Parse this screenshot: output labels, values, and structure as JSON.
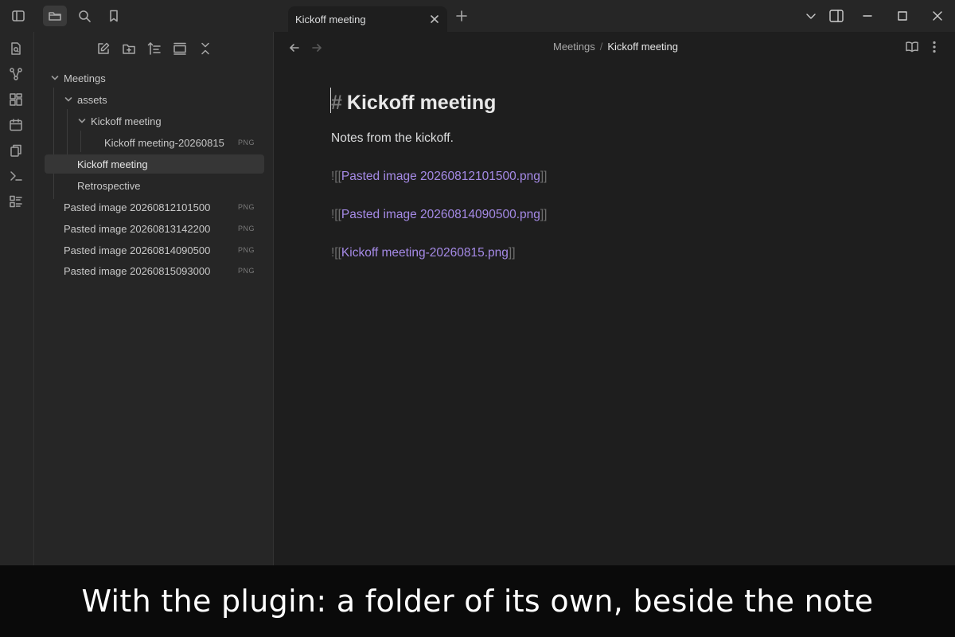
{
  "tab": {
    "title": "Kickoff meeting"
  },
  "file_tree": [
    {
      "label": "Meetings",
      "kind": "folder",
      "expanded": true
    },
    {
      "label": "assets",
      "kind": "folder",
      "expanded": true
    },
    {
      "label": "Kickoff meeting",
      "kind": "folder",
      "expanded": true
    },
    {
      "label": "Kickoff meeting-20260815",
      "kind": "file",
      "badge": "PNG"
    },
    {
      "label": "Kickoff meeting",
      "kind": "note",
      "selected": true
    },
    {
      "label": "Retrospective",
      "kind": "note"
    },
    {
      "label": "Pasted image 20260812101500",
      "kind": "file",
      "badge": "PNG"
    },
    {
      "label": "Pasted image 20260813142200",
      "kind": "file",
      "badge": "PNG"
    },
    {
      "label": "Pasted image 20260814090500",
      "kind": "file",
      "badge": "PNG"
    },
    {
      "label": "Pasted image 20260815093000",
      "kind": "file",
      "badge": "PNG"
    }
  ],
  "breadcrumb": {
    "parent": "Meetings",
    "separator": "/",
    "current": "Kickoff meeting"
  },
  "editor": {
    "heading_marker": "#",
    "heading": "Kickoff meeting",
    "paragraph": "Notes from the kickoff.",
    "embeds": [
      {
        "open": "![[",
        "target": "Pasted image 20260812101500.png",
        "close": "]]"
      },
      {
        "open": "![[",
        "target": "Pasted image 20260814090500.png",
        "close": "]]"
      },
      {
        "open": "![[",
        "target": "Kickoff meeting-20260815.png",
        "close": "]]"
      }
    ]
  },
  "caption": "With the plugin: a folder of its own, beside the note",
  "colors": {
    "background": "#1e1e1e",
    "sidebar": "#262626",
    "link": "#a58ae6",
    "selected_row": "#363636"
  }
}
